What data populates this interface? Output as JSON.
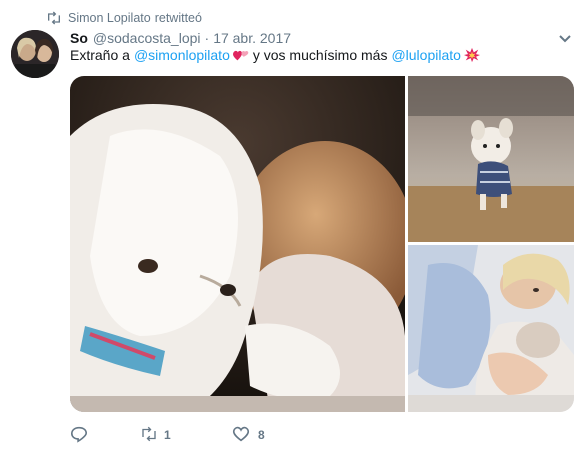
{
  "retweet_context": {
    "user": "Simon Lopilato",
    "action": "retwitteó",
    "icon": "retweet-icon"
  },
  "tweet": {
    "author_name": "So",
    "handle": "@sodacosta_lopi",
    "separator": "·",
    "time": "17 abr. 2017",
    "text_parts": {
      "t1": "Extraño a",
      "mention1": "@simonlopilato",
      "t2": "y vos muchísimo más",
      "mention2": "@lulopilato"
    },
    "emojis": [
      "two-hearts-emoji",
      "collision-emoji"
    ]
  },
  "media": {
    "photos": [
      {
        "subject": "white-dog-with-baby-photo"
      },
      {
        "subject": "dog-walking-on-grass-photo"
      },
      {
        "subject": "woman-lying-with-dog-photo"
      }
    ]
  },
  "actions": {
    "reply": {
      "icon": "reply-icon"
    },
    "retweet": {
      "icon": "retweet-icon",
      "count": "1"
    },
    "like": {
      "icon": "heart-icon",
      "count": "8"
    }
  },
  "colors": {
    "link": "#1da1f2",
    "muted": "#657786",
    "text": "#14171a"
  }
}
